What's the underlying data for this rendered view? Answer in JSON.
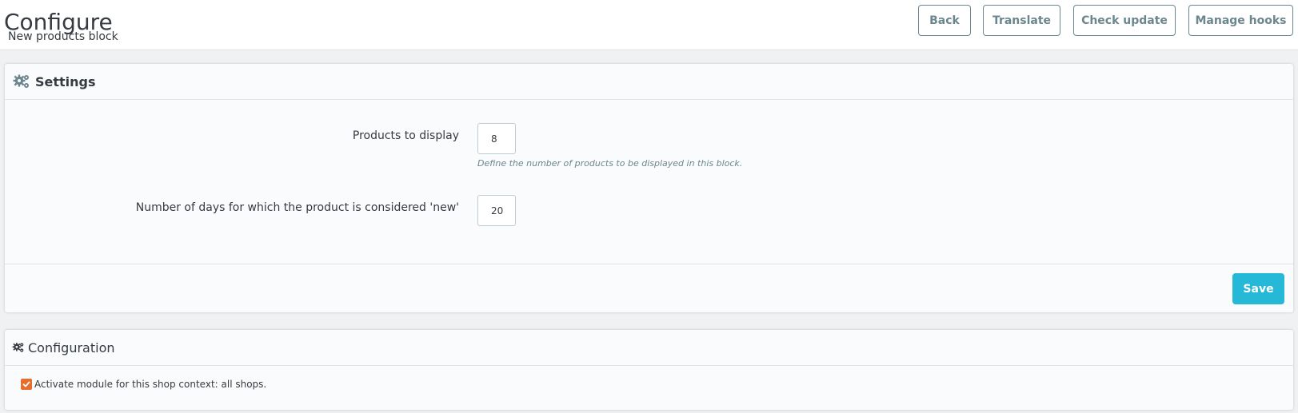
{
  "header": {
    "title": "Configure",
    "subtitle": "New products block"
  },
  "toolbar": {
    "back_label": "Back",
    "translate_label": "Translate",
    "check_update_label": "Check update",
    "manage_hooks_label": "Manage hooks"
  },
  "settings_panel": {
    "heading": "Settings",
    "icon": "gears-icon",
    "fields": [
      {
        "label": "Products to display",
        "value": "8",
        "help": "Define the number of products to be displayed in this block."
      },
      {
        "label": "Number of days for which the product is considered 'new'",
        "value": "20"
      }
    ],
    "save_label": "Save"
  },
  "config_panel": {
    "heading": "Configuration",
    "icon": "gears-icon",
    "activate_label": "Activate module for this shop context: all shops.",
    "activate_checked": true
  },
  "colors": {
    "primary": "#25b9d7",
    "checkbox": "#e76d2c",
    "text": "#363a41",
    "muted": "#6c868e"
  }
}
